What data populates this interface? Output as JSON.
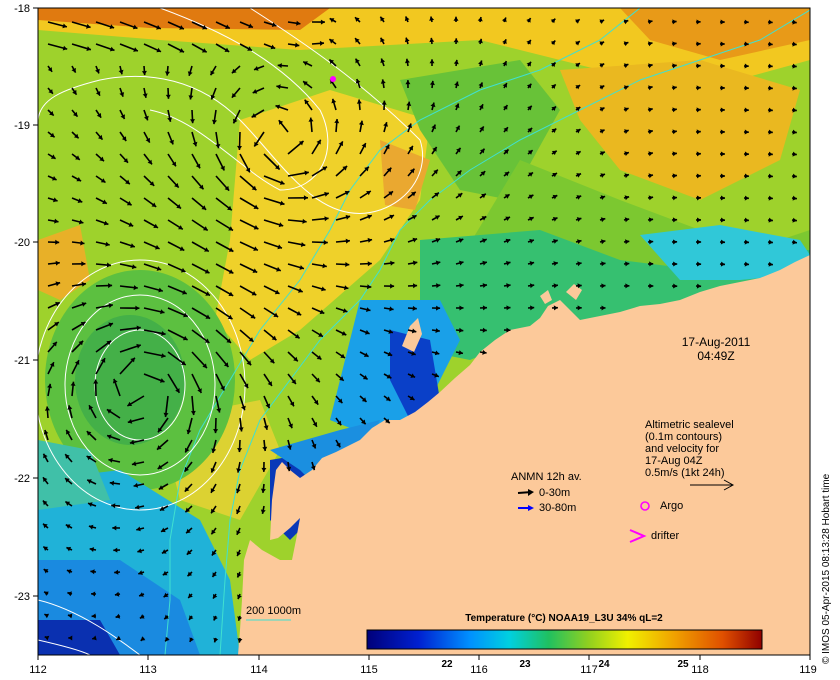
{
  "map": {
    "lon_ticks": [
      "112",
      "113",
      "114",
      "115",
      "116",
      "117",
      "118",
      "119"
    ],
    "lat_ticks": [
      "-18",
      "-19",
      "-20",
      "-21",
      "-22",
      "-23"
    ],
    "lon_range": [
      112,
      119
    ],
    "lat_range": [
      -23.55,
      -18.0
    ],
    "land_color": "#fcc99a",
    "date": "17-Aug-2011",
    "time": "04:49Z"
  },
  "legend": {
    "altimetric": [
      "Altimetric sealevel",
      "(0.1m contours)",
      "and velocity for",
      "17-Aug 04Z",
      "0.5m/s (1kt 24h)"
    ],
    "anmn_title": "ANMN 12h av.",
    "anmn_items": [
      {
        "label": "0-30m",
        "color": "#000000"
      },
      {
        "label": "30-80m",
        "color": "#0000ff"
      }
    ],
    "argo_label": "Argo",
    "drifter_label": "drifter",
    "marker_color": "#ff00ff",
    "bathy_label": "200  1000m",
    "bathy_color": "#40e0d0"
  },
  "colorbar": {
    "title": "Temperature (°C) NOAA19_L3U 34% qL=2",
    "ticks": [
      "22",
      "23",
      "24",
      "25"
    ],
    "range": [
      21.1,
      25.8
    ]
  },
  "credit": "© IMOS 05-Apr-2015 08:13:28 Hobart time"
}
